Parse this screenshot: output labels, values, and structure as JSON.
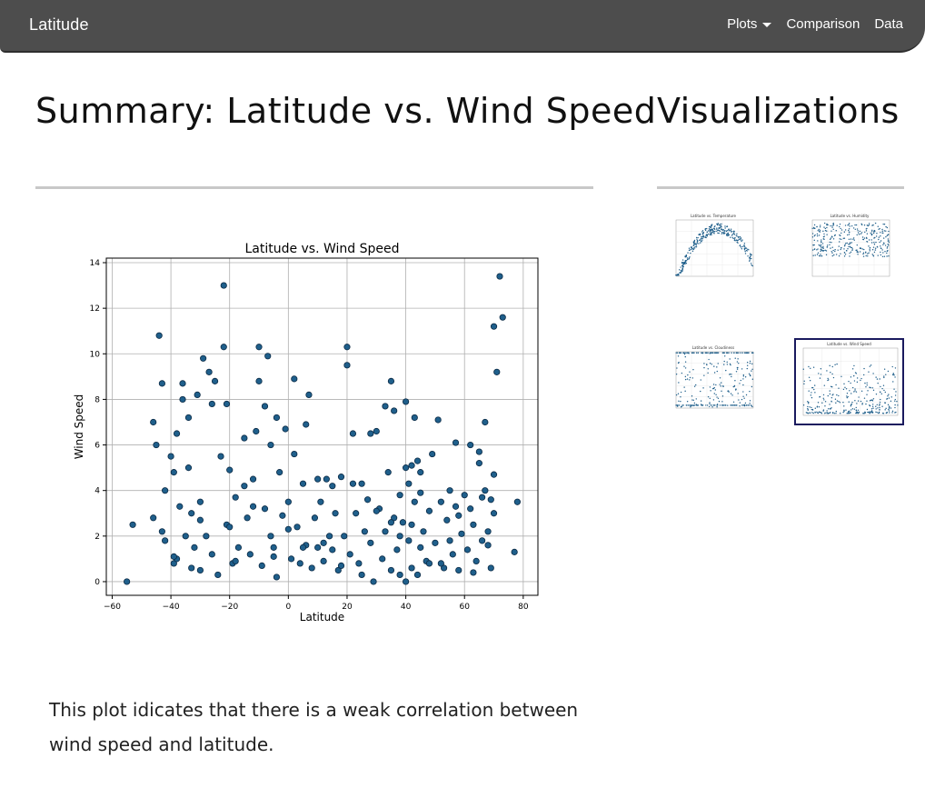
{
  "navbar": {
    "brand": "Latitude",
    "links": [
      {
        "label": "Plots",
        "dropdown": true
      },
      {
        "label": "Comparison"
      },
      {
        "label": "Data"
      }
    ]
  },
  "main": {
    "title": "Summary: Latitude vs. Wind Speed",
    "description": "This plot idicates that there is a weak correlation between wind speed and latitude."
  },
  "sidebar": {
    "title": "Visualizations",
    "thumbnails": [
      {
        "title": "Latitude vs. Temperature"
      },
      {
        "title": "Latitude vs. Humidity"
      },
      {
        "title": "Latitude vs. Cloudiness"
      },
      {
        "title": "Latitude vs. Wind Speed",
        "active": true
      }
    ]
  },
  "colors": {
    "marker": "#1f5f8b",
    "marker_edge": "#0b2a45",
    "navbar": "#4d4d4d"
  },
  "chart_data": {
    "type": "scatter",
    "title": "Latitude vs. Wind Speed",
    "xlabel": "Latitude",
    "ylabel": "Wind Speed",
    "xlim": [
      -62,
      85
    ],
    "ylim": [
      -0.6,
      14.2
    ],
    "xticks": [
      -60,
      -40,
      -20,
      0,
      20,
      40,
      60,
      80
    ],
    "yticks": [
      0,
      2,
      4,
      6,
      8,
      10,
      12,
      14
    ],
    "grid": true,
    "x": [
      -55,
      -53,
      -46,
      -46,
      -45,
      -43,
      -43,
      -42,
      -42,
      -40,
      -39,
      -39,
      -38,
      -38,
      -37,
      -36,
      -35,
      -34,
      -34,
      -33,
      -33,
      -32,
      -31,
      -30,
      -30,
      -29,
      -28,
      -27,
      -26,
      -25,
      -24,
      -23,
      -22,
      -22,
      -21,
      -21,
      -20,
      -19,
      -18,
      -17,
      -15,
      -14,
      -13,
      -12,
      -11,
      -10,
      -10,
      -9,
      -8,
      -7,
      -6,
      -6,
      -5,
      -4,
      -4,
      -3,
      -2,
      -1,
      0,
      1,
      2,
      3,
      4,
      5,
      6,
      6,
      7,
      8,
      9,
      10,
      11,
      12,
      13,
      14,
      15,
      16,
      17,
      18,
      19,
      20,
      20,
      21,
      22,
      23,
      24,
      25,
      26,
      27,
      28,
      29,
      30,
      31,
      32,
      33,
      34,
      35,
      35,
      36,
      36,
      37,
      38,
      38,
      39,
      40,
      40,
      40,
      41,
      41,
      42,
      42,
      43,
      43,
      44,
      45,
      45,
      46,
      47,
      48,
      49,
      50,
      51,
      52,
      53,
      54,
      55,
      56,
      57,
      58,
      59,
      60,
      61,
      62,
      63,
      64,
      65,
      66,
      67,
      67,
      68,
      69,
      69,
      70,
      70,
      71,
      72,
      73,
      77,
      78,
      -44,
      -36,
      -26,
      -18,
      -8,
      2,
      12,
      22,
      33,
      44,
      52,
      62,
      68,
      -30,
      -12,
      5,
      15,
      28,
      38,
      48,
      57,
      66,
      -20,
      -5,
      10,
      25,
      35,
      45,
      55,
      65,
      70,
      -39,
      -15,
      0,
      18,
      30,
      42,
      58,
      63
    ],
    "y": [
      0,
      2.5,
      7,
      2.8,
      6,
      8.7,
      2.2,
      4,
      1.8,
      5.5,
      0.8,
      4.8,
      6.5,
      1,
      3.3,
      8.7,
      2,
      7.2,
      5,
      3,
      0.6,
      1.5,
      8.2,
      3.5,
      0.5,
      9.8,
      2,
      9.2,
      1.2,
      8.8,
      0.3,
      5.5,
      13,
      10.3,
      7.8,
      2.5,
      4.9,
      0.8,
      3.7,
      1.5,
      6.3,
      2.8,
      1.2,
      4.5,
      6.6,
      10.3,
      8.8,
      0.7,
      3.2,
      9.9,
      2,
      6,
      1.5,
      7.2,
      0.2,
      4.8,
      2.9,
      6.7,
      3.5,
      1,
      8.9,
      2.4,
      0.8,
      4.3,
      1.6,
      6.9,
      8.2,
      0.6,
      2.8,
      1.5,
      3.5,
      0.9,
      4.5,
      2,
      1.4,
      3,
      0.5,
      4.6,
      2,
      10.3,
      9.5,
      1.2,
      6.5,
      3,
      0.8,
      4.3,
      2.2,
      3.6,
      1.7,
      0,
      6.6,
      3.2,
      1,
      7.7,
      4.8,
      8.8,
      0.5,
      2.8,
      7.5,
      1.4,
      3.8,
      0.3,
      2.6,
      7.9,
      5,
      0,
      1.8,
      4.3,
      0.6,
      2.5,
      7.2,
      3.5,
      0.3,
      1.5,
      4.8,
      2.2,
      0.9,
      3.1,
      5.6,
      1.7,
      7.1,
      3.5,
      0.6,
      2.7,
      4,
      1.2,
      3.3,
      0.5,
      2.1,
      3.8,
      1.4,
      6,
      2.5,
      0.9,
      5.2,
      1.8,
      4,
      7,
      2.2,
      0.6,
      3.6,
      11.2,
      4.7,
      9.2,
      13.4,
      11.6,
      1.3,
      3.5,
      10.8,
      8,
      7.8,
      0.9,
      7.7,
      5.6,
      1.7,
      4.3,
      2.2,
      5.3,
      0.8,
      3.2,
      1.6,
      2.7,
      3.3,
      1.5,
      4.2,
      6.5,
      2,
      0.8,
      6.1,
      3.7,
      2.4,
      1.1,
      4.5,
      0.3,
      2.6,
      3.9,
      1.8,
      5.7,
      3,
      1.1,
      4.2,
      2.3,
      0.7,
      3.1,
      5.1,
      2.9,
      0.4,
      1.3,
      4.1,
      2.8,
      3.4,
      1.9,
      0.9,
      3,
      2.1,
      4.9
    ]
  }
}
